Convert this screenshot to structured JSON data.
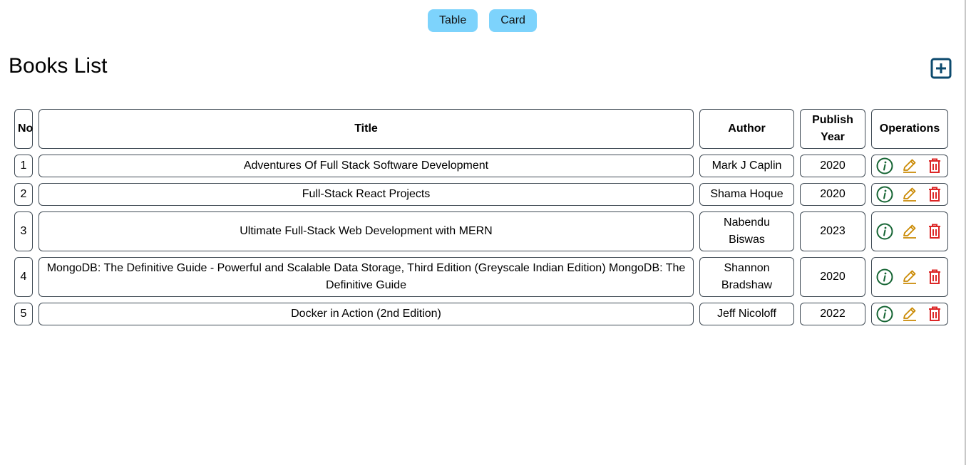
{
  "view_toggle": {
    "table_label": "Table",
    "card_label": "Card"
  },
  "header": {
    "title": "Books List",
    "add_icon": "plus-square-icon"
  },
  "table": {
    "columns": [
      "No",
      "Title",
      "Author",
      "Publish Year",
      "Operations"
    ],
    "rows": [
      {
        "no": "1",
        "title": "Adventures Of Full Stack Software Development",
        "author": "Mark J Caplin",
        "year": "2020"
      },
      {
        "no": "2",
        "title": "Full-Stack React Projects",
        "author": "Shama Hoque",
        "year": "2020"
      },
      {
        "no": "3",
        "title": "Ultimate Full-Stack Web Development with MERN",
        "author": "Nabendu Biswas",
        "year": "2023"
      },
      {
        "no": "4",
        "title": "MongoDB: The Definitive Guide - Powerful and Scalable Data Storage, Third Edition (Greyscale Indian Edition) MongoDB: The Definitive Guide",
        "author": "Shannon Bradshaw",
        "year": "2020"
      },
      {
        "no": "5",
        "title": "Docker in Action (2nd Edition)",
        "author": "Jeff Nicoloff",
        "year": "2022"
      }
    ],
    "operations": [
      {
        "name": "info-icon",
        "color": "#166534"
      },
      {
        "name": "edit-icon",
        "color": "#ca8a04"
      },
      {
        "name": "delete-icon",
        "color": "#dc2626"
      }
    ]
  },
  "colors": {
    "toggle_bg": "#7dd3fc",
    "add_icon": "#0c4a6e",
    "border": "#3f4a54"
  }
}
